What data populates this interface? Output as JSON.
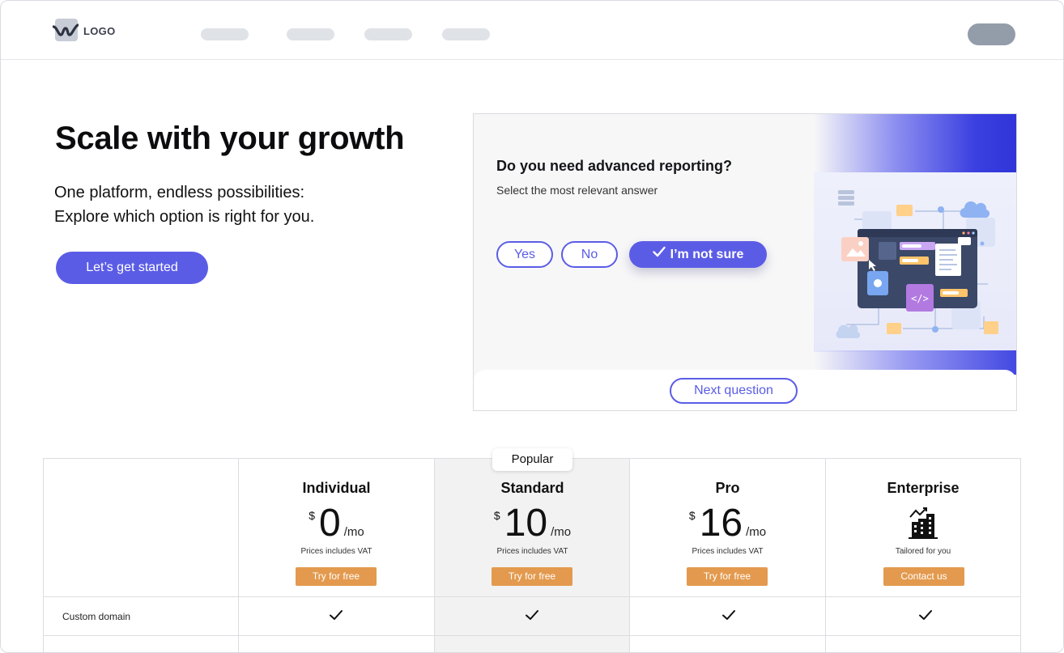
{
  "header": {
    "logo_text": "LOGO"
  },
  "hero": {
    "title": "Scale with your growth",
    "subtitle_line1": "One platform, endless possibilities:",
    "subtitle_line2": "Explore which option is right for you.",
    "cta_label": "Let’s get started"
  },
  "quiz": {
    "question": "Do you need advanced reporting?",
    "hint": "Select the most relevant answer",
    "options": [
      {
        "label": "Yes",
        "selected": false
      },
      {
        "label": "No",
        "selected": false
      },
      {
        "label": "I’m not sure",
        "selected": true
      }
    ],
    "next_label": "Next question",
    "accent_color": "#5b5ce6"
  },
  "pricing": {
    "popular_badge": "Popular",
    "plans": [
      {
        "name": "Individual",
        "currency": "$",
        "amount": "0",
        "period": "/mo",
        "note": "Prices includes VAT",
        "button": "Try for free"
      },
      {
        "name": "Standard",
        "currency": "$",
        "amount": "10",
        "period": "/mo",
        "note": "Prices includes VAT",
        "button": "Try for free"
      },
      {
        "name": "Pro",
        "currency": "$",
        "amount": "16",
        "period": "/mo",
        "note": "Prices includes VAT",
        "button": "Try for free"
      },
      {
        "name": "Enterprise",
        "icon": "building-icon",
        "note": "Tailored for you",
        "button": "Contact us"
      }
    ],
    "features": [
      {
        "label": "Custom domain"
      }
    ],
    "button_color": "#e39a4e"
  }
}
